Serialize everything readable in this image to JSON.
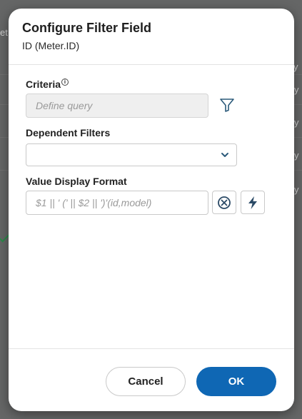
{
  "dialog": {
    "title": "Configure Filter Field",
    "subtitle": "ID (Meter.ID)"
  },
  "criteria": {
    "label": "Criteria",
    "placeholder": "Define query"
  },
  "dependent_filters": {
    "label": "Dependent Filters",
    "value": ""
  },
  "value_display_format": {
    "label": "Value Display Format",
    "placeholder": "$1 || ' (' || $2 || ')'(id,model)"
  },
  "buttons": {
    "cancel": "Cancel",
    "ok": "OK"
  },
  "background": {
    "fragments": [
      "y",
      "et",
      "y",
      "y",
      "y",
      "y"
    ]
  },
  "colors": {
    "primary": "#0f67b4",
    "overlay": "#3a3a3a"
  }
}
